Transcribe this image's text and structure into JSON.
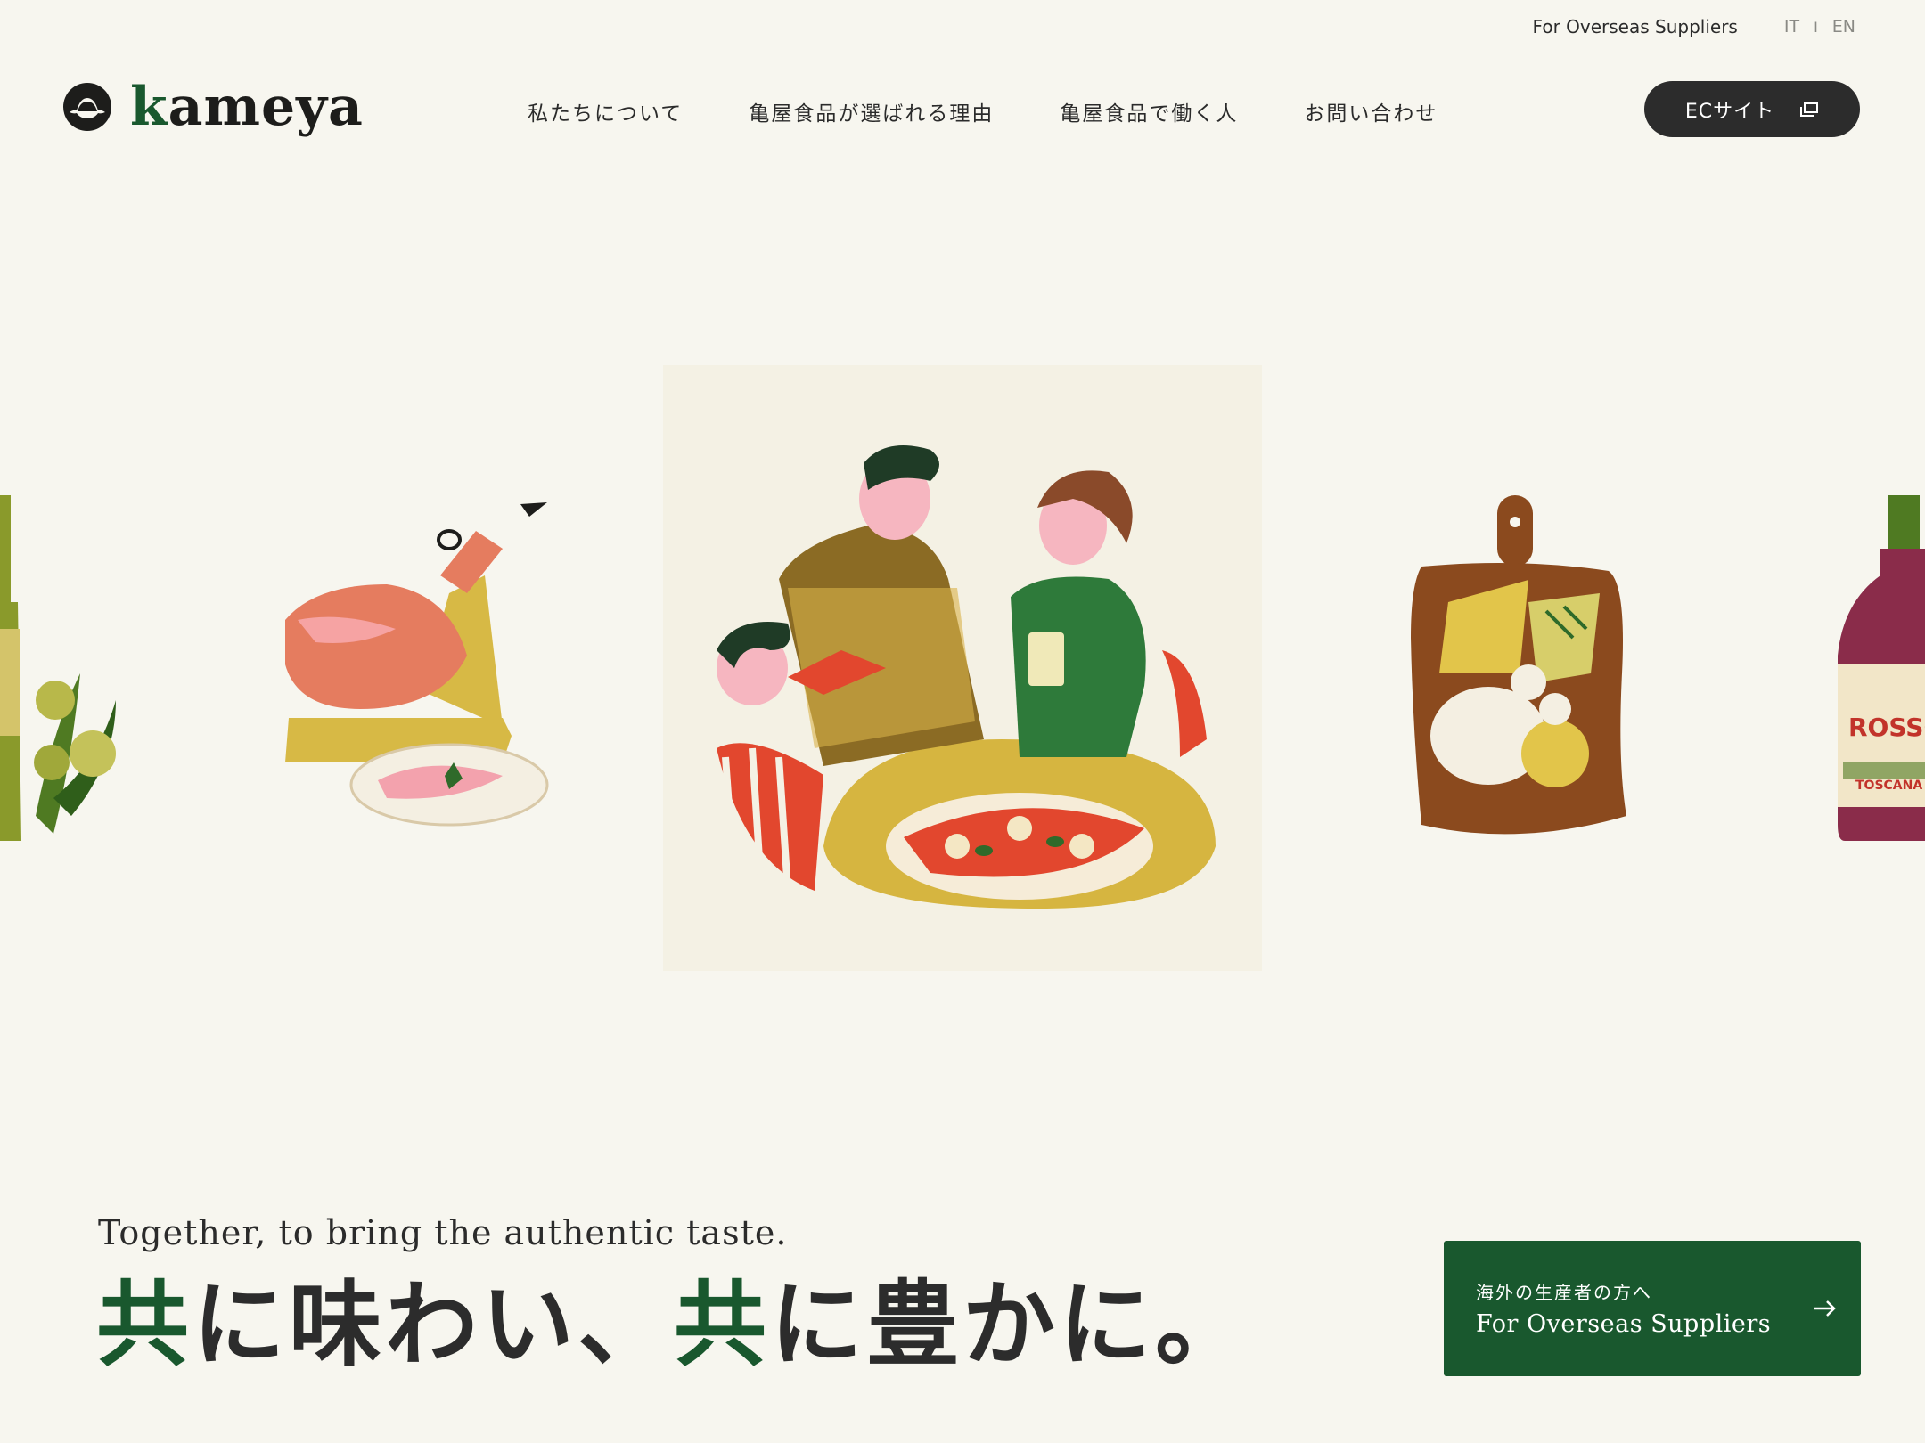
{
  "utility": {
    "suppliers_link": "For Overseas Suppliers",
    "lang_it": "IT",
    "lang_sep": "I",
    "lang_en": "EN"
  },
  "brand": {
    "logo_initial": "k",
    "logo_rest": "ameya"
  },
  "nav": {
    "items": [
      {
        "label": "私たちについて"
      },
      {
        "label": "亀屋食品が選ばれる理由"
      },
      {
        "label": "亀屋食品で働く人"
      },
      {
        "label": "お問い合わせ"
      }
    ],
    "ec_label": "ECサイト"
  },
  "hero": {
    "tagline_en": "Together, to bring the authentic taste.",
    "tagline_ja_parts": [
      "共",
      "に味わい、",
      "共",
      "に豊かに。"
    ]
  },
  "supplier_cta": {
    "label_ja": "海外の生産者の方へ",
    "label_en": "For Overseas Suppliers"
  },
  "illustration_text": {
    "wine_label": "ROSSO",
    "wine_sub": "TOSCANA"
  },
  "colors": {
    "background": "#f7f6ef",
    "brand_green": "#19582e",
    "dark": "#2c2c2c"
  }
}
